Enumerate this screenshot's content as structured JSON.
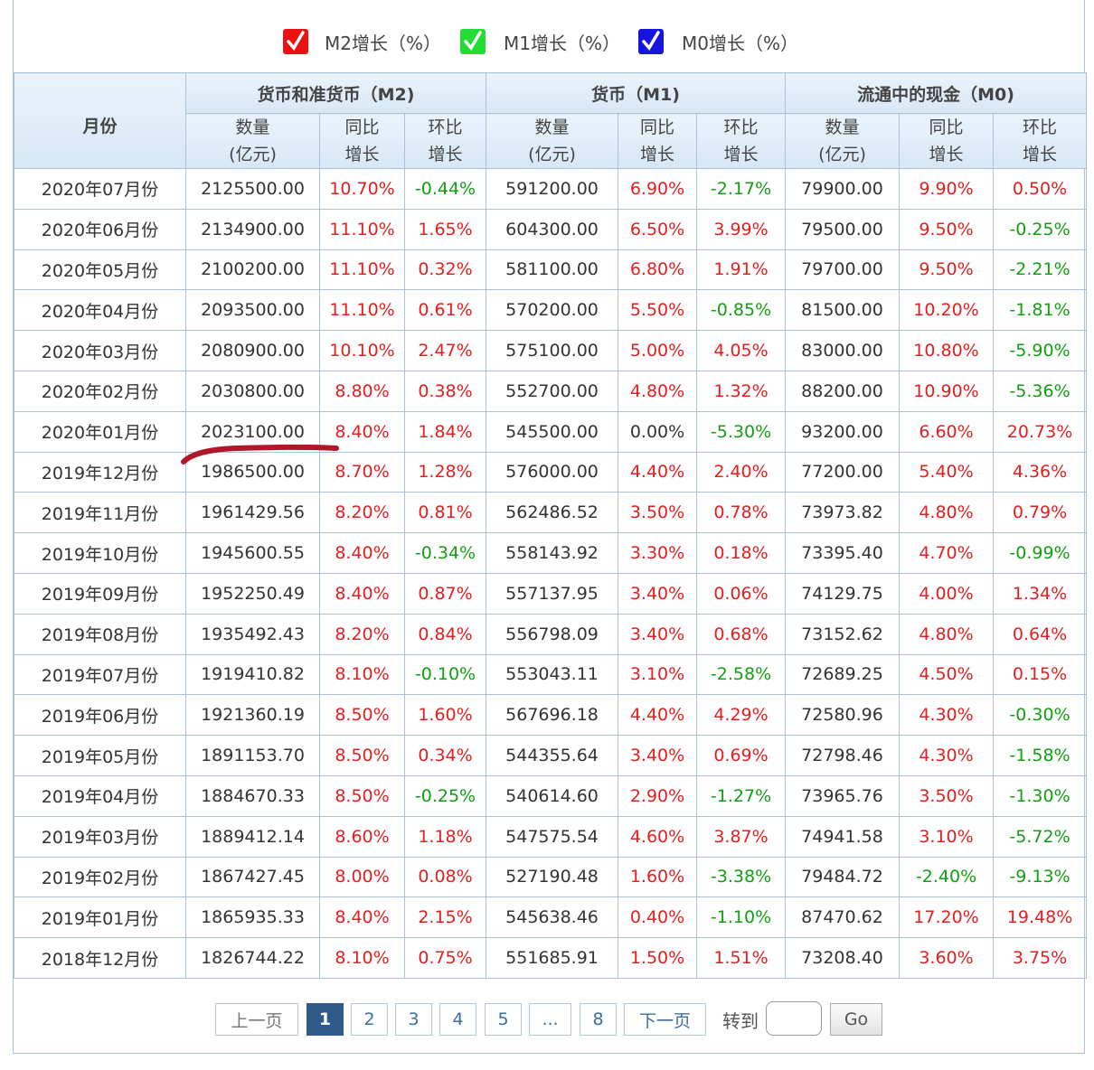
{
  "legend": [
    {
      "label": "M2增长（%）",
      "color": "#ee1111"
    },
    {
      "label": "M1增长（%）",
      "color": "#22dd33"
    },
    {
      "label": "M0增长（%）",
      "color": "#1515dd"
    }
  ],
  "header": {
    "month": "月份",
    "groups": [
      "货币和准货币（M2)",
      "货币（M1)",
      "流通中的现金（M0)"
    ],
    "sub": [
      {
        "l1": "数量",
        "l2": "(亿元)"
      },
      {
        "l1": "同比",
        "l2": "增长"
      },
      {
        "l1": "环比",
        "l2": "增长"
      }
    ]
  },
  "colors": {
    "up": "#e61e1e",
    "down": "#12a012",
    "neutral": "#333333",
    "header_bg": "#dceaf7",
    "border": "#a9c3dc",
    "pager_active": "#2f5b8a"
  },
  "rows": [
    [
      "2020年07月份",
      "2125500.00",
      "10.70%",
      "-0.44%",
      "591200.00",
      "6.90%",
      "-2.17%",
      "79900.00",
      "9.90%",
      "0.50%"
    ],
    [
      "2020年06月份",
      "2134900.00",
      "11.10%",
      "1.65%",
      "604300.00",
      "6.50%",
      "3.99%",
      "79500.00",
      "9.50%",
      "-0.25%"
    ],
    [
      "2020年05月份",
      "2100200.00",
      "11.10%",
      "0.32%",
      "581100.00",
      "6.80%",
      "1.91%",
      "79700.00",
      "9.50%",
      "-2.21%"
    ],
    [
      "2020年04月份",
      "2093500.00",
      "11.10%",
      "0.61%",
      "570200.00",
      "5.50%",
      "-0.85%",
      "81500.00",
      "10.20%",
      "-1.81%"
    ],
    [
      "2020年03月份",
      "2080900.00",
      "10.10%",
      "2.47%",
      "575100.00",
      "5.00%",
      "4.05%",
      "83000.00",
      "10.80%",
      "-5.90%"
    ],
    [
      "2020年02月份",
      "2030800.00",
      "8.80%",
      "0.38%",
      "552700.00",
      "4.80%",
      "1.32%",
      "88200.00",
      "10.90%",
      "-5.36%"
    ],
    [
      "2020年01月份",
      "2023100.00",
      "8.40%",
      "1.84%",
      "545500.00",
      "0.00%",
      "-5.30%",
      "93200.00",
      "6.60%",
      "20.73%"
    ],
    [
      "2019年12月份",
      "1986500.00",
      "8.70%",
      "1.28%",
      "576000.00",
      "4.40%",
      "2.40%",
      "77200.00",
      "5.40%",
      "4.36%"
    ],
    [
      "2019年11月份",
      "1961429.56",
      "8.20%",
      "0.81%",
      "562486.52",
      "3.50%",
      "0.78%",
      "73973.82",
      "4.80%",
      "0.79%"
    ],
    [
      "2019年10月份",
      "1945600.55",
      "8.40%",
      "-0.34%",
      "558143.92",
      "3.30%",
      "0.18%",
      "73395.40",
      "4.70%",
      "-0.99%"
    ],
    [
      "2019年09月份",
      "1952250.49",
      "8.40%",
      "0.87%",
      "557137.95",
      "3.40%",
      "0.06%",
      "74129.75",
      "4.00%",
      "1.34%"
    ],
    [
      "2019年08月份",
      "1935492.43",
      "8.20%",
      "0.84%",
      "556798.09",
      "3.40%",
      "0.68%",
      "73152.62",
      "4.80%",
      "0.64%"
    ],
    [
      "2019年07月份",
      "1919410.82",
      "8.10%",
      "-0.10%",
      "553043.11",
      "3.10%",
      "-2.58%",
      "72689.25",
      "4.50%",
      "0.15%"
    ],
    [
      "2019年06月份",
      "1921360.19",
      "8.50%",
      "1.60%",
      "567696.18",
      "4.40%",
      "4.29%",
      "72580.96",
      "4.30%",
      "-0.30%"
    ],
    [
      "2019年05月份",
      "1891153.70",
      "8.50%",
      "0.34%",
      "544355.64",
      "3.40%",
      "0.69%",
      "72798.46",
      "4.30%",
      "-1.58%"
    ],
    [
      "2019年04月份",
      "1884670.33",
      "8.50%",
      "-0.25%",
      "540614.60",
      "2.90%",
      "-1.27%",
      "73965.76",
      "3.50%",
      "-1.30%"
    ],
    [
      "2019年03月份",
      "1889412.14",
      "8.60%",
      "1.18%",
      "547575.54",
      "4.60%",
      "3.87%",
      "74941.58",
      "3.10%",
      "-5.72%"
    ],
    [
      "2019年02月份",
      "1867427.45",
      "8.00%",
      "0.08%",
      "527190.48",
      "1.60%",
      "-3.38%",
      "79484.72",
      "-2.40%",
      "-9.13%"
    ],
    [
      "2019年01月份",
      "1865935.33",
      "8.40%",
      "2.15%",
      "545638.46",
      "0.40%",
      "-1.10%",
      "87470.62",
      "17.20%",
      "19.48%"
    ],
    [
      "2018年12月份",
      "1826744.22",
      "8.10%",
      "0.75%",
      "551685.91",
      "1.50%",
      "1.51%",
      "73208.40",
      "3.60%",
      "3.75%"
    ]
  ],
  "pager": {
    "prev": "上一页",
    "pages": [
      "1",
      "2",
      "3",
      "4",
      "5",
      "...",
      "8"
    ],
    "current": "1",
    "next": "下一页",
    "goto_label": "转到",
    "goto_value": "",
    "go": "Go"
  }
}
